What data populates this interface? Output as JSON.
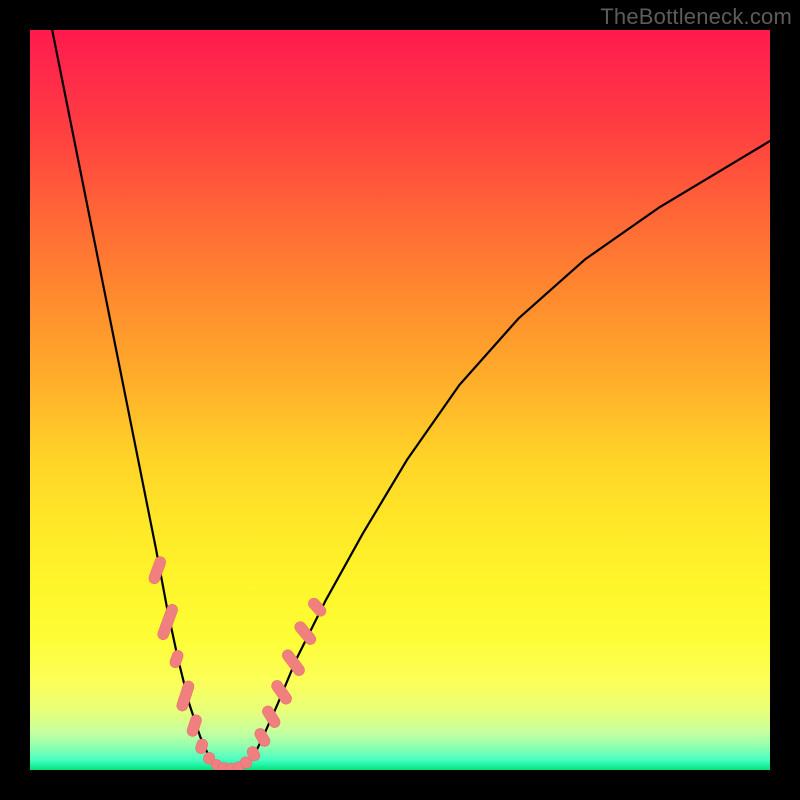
{
  "watermark": "TheBottleneck.com",
  "colors": {
    "frame": "#000000",
    "curve_stroke": "#000000",
    "marker_fill": "#f08080",
    "marker_stroke": "#e46b6b"
  },
  "chart_data": {
    "type": "line",
    "title": "",
    "xlabel": "",
    "ylabel": "",
    "xlim": [
      0,
      100
    ],
    "ylim": [
      0,
      100
    ],
    "curve": {
      "comment": "Two asymptotic-like branches meeting near the bottom; V-shape with rounded trough. Points are (x_pct, y_bottleneck_pct) where y=0 is green bottom and y=100 is red top.",
      "left_branch": [
        [
          3,
          100
        ],
        [
          5,
          90
        ],
        [
          7,
          80
        ],
        [
          9,
          70
        ],
        [
          11,
          60
        ],
        [
          13,
          50
        ],
        [
          15,
          40
        ],
        [
          17,
          30
        ],
        [
          18.5,
          22
        ],
        [
          20,
          15
        ],
        [
          21.5,
          9
        ],
        [
          23,
          4.5
        ],
        [
          24.2,
          1.8
        ],
        [
          25.2,
          0.6
        ],
        [
          26,
          0.15
        ]
      ],
      "trough": [
        [
          26,
          0.15
        ],
        [
          26.8,
          0.05
        ],
        [
          27.6,
          0.05
        ],
        [
          28.4,
          0.15
        ]
      ],
      "right_branch": [
        [
          28.4,
          0.15
        ],
        [
          29.2,
          0.6
        ],
        [
          30.2,
          1.8
        ],
        [
          31.5,
          4.5
        ],
        [
          33.5,
          9
        ],
        [
          36,
          15
        ],
        [
          40,
          23
        ],
        [
          45,
          32
        ],
        [
          51,
          42
        ],
        [
          58,
          52
        ],
        [
          66,
          61
        ],
        [
          75,
          69
        ],
        [
          85,
          76
        ],
        [
          95,
          82
        ],
        [
          100,
          85
        ]
      ]
    },
    "markers": {
      "comment": "salmon oblong markers on lower parts of both branches representing benchmarked hardware points; (x_pct, y_pct, length_pct, angle_deg)",
      "points": [
        [
          17.2,
          27,
          3.8,
          70
        ],
        [
          18.6,
          20,
          5.0,
          70
        ],
        [
          19.8,
          15,
          2.4,
          70
        ],
        [
          21.0,
          10,
          4.2,
          72
        ],
        [
          22.2,
          6.0,
          3.0,
          72
        ],
        [
          23.2,
          3.2,
          2.0,
          73
        ],
        [
          24.2,
          1.6,
          1.6,
          60
        ],
        [
          25.2,
          0.7,
          1.4,
          40
        ],
        [
          26.2,
          0.25,
          1.6,
          10
        ],
        [
          27.2,
          0.2,
          1.6,
          -5
        ],
        [
          28.2,
          0.4,
          1.4,
          -30
        ],
        [
          29.2,
          1.0,
          1.6,
          -55
        ],
        [
          30.2,
          2.2,
          2.0,
          -63
        ],
        [
          31.4,
          4.4,
          2.6,
          -60
        ],
        [
          32.6,
          7.2,
          3.2,
          -58
        ],
        [
          34.0,
          10.5,
          3.6,
          -55
        ],
        [
          35.6,
          14.5,
          4.0,
          -53
        ],
        [
          37.2,
          18.5,
          3.6,
          -50
        ],
        [
          38.8,
          22.0,
          2.8,
          -48
        ]
      ]
    },
    "haze_band": {
      "comment": "The pale yellow haze band near the bottom of the gradient",
      "top_pct_from_bottom": 18,
      "bottom_pct_from_bottom": 5
    }
  }
}
